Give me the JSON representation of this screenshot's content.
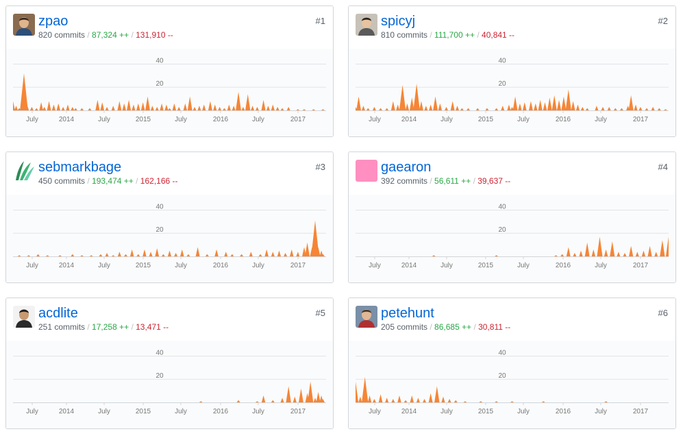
{
  "colors": {
    "area": "#f68535",
    "link": "#0366d6",
    "additions": "#28a745",
    "deletions": "#cb2431",
    "gridline": "#e1e4e8"
  },
  "axis": {
    "y_ticks": [
      "20",
      "40"
    ],
    "x_ticks": [
      "July",
      "2014",
      "July",
      "2015",
      "July",
      "2016",
      "July",
      "2017"
    ]
  },
  "contributors": [
    {
      "rank": "#1",
      "username": "zpao",
      "avatar": "photo-avatar",
      "commits": "820 commits",
      "additions": "87,324 ++",
      "deletions": "131,910 --",
      "chart_data": {
        "type": "area",
        "ylim": [
          0,
          45
        ],
        "peaks": [
          [
            0.0,
            8
          ],
          [
            0.01,
            4
          ],
          [
            0.02,
            2
          ],
          [
            0.035,
            32
          ],
          [
            0.045,
            5
          ],
          [
            0.06,
            3
          ],
          [
            0.075,
            2
          ],
          [
            0.09,
            7
          ],
          [
            0.1,
            3
          ],
          [
            0.115,
            8
          ],
          [
            0.13,
            5
          ],
          [
            0.145,
            6
          ],
          [
            0.16,
            3
          ],
          [
            0.175,
            5
          ],
          [
            0.19,
            3
          ],
          [
            0.2,
            2
          ],
          [
            0.22,
            2
          ],
          [
            0.245,
            2
          ],
          [
            0.27,
            9
          ],
          [
            0.285,
            7
          ],
          [
            0.3,
            3
          ],
          [
            0.32,
            4
          ],
          [
            0.34,
            8
          ],
          [
            0.355,
            6
          ],
          [
            0.37,
            9
          ],
          [
            0.385,
            5
          ],
          [
            0.4,
            6
          ],
          [
            0.415,
            7
          ],
          [
            0.43,
            12
          ],
          [
            0.445,
            4
          ],
          [
            0.46,
            3
          ],
          [
            0.475,
            6
          ],
          [
            0.49,
            5
          ],
          [
            0.5,
            2
          ],
          [
            0.515,
            6
          ],
          [
            0.53,
            3
          ],
          [
            0.55,
            6
          ],
          [
            0.565,
            12
          ],
          [
            0.58,
            3
          ],
          [
            0.595,
            4
          ],
          [
            0.61,
            5
          ],
          [
            0.63,
            8
          ],
          [
            0.645,
            5
          ],
          [
            0.66,
            3
          ],
          [
            0.675,
            2
          ],
          [
            0.69,
            5
          ],
          [
            0.705,
            4
          ],
          [
            0.72,
            16
          ],
          [
            0.735,
            3
          ],
          [
            0.75,
            14
          ],
          [
            0.765,
            4
          ],
          [
            0.78,
            3
          ],
          [
            0.8,
            9
          ],
          [
            0.815,
            4
          ],
          [
            0.83,
            5
          ],
          [
            0.845,
            3
          ],
          [
            0.86,
            2
          ],
          [
            0.88,
            3
          ],
          [
            0.91,
            1
          ],
          [
            0.93,
            1
          ],
          [
            0.96,
            1
          ],
          [
            0.99,
            1
          ]
        ]
      }
    },
    {
      "rank": "#2",
      "username": "spicyj",
      "avatar": "photo-avatar",
      "commits": "810 commits",
      "additions": "111,700 ++",
      "deletions": "40,841 --",
      "chart_data": {
        "type": "area",
        "ylim": [
          0,
          45
        ],
        "peaks": [
          [
            0.0,
            3
          ],
          [
            0.01,
            12
          ],
          [
            0.025,
            4
          ],
          [
            0.04,
            2
          ],
          [
            0.06,
            3
          ],
          [
            0.08,
            2
          ],
          [
            0.1,
            2
          ],
          [
            0.12,
            8
          ],
          [
            0.135,
            5
          ],
          [
            0.15,
            22
          ],
          [
            0.165,
            6
          ],
          [
            0.18,
            11
          ],
          [
            0.195,
            23
          ],
          [
            0.21,
            8
          ],
          [
            0.225,
            4
          ],
          [
            0.24,
            5
          ],
          [
            0.255,
            12
          ],
          [
            0.27,
            6
          ],
          [
            0.29,
            3
          ],
          [
            0.31,
            8
          ],
          [
            0.325,
            4
          ],
          [
            0.34,
            2
          ],
          [
            0.36,
            2
          ],
          [
            0.39,
            2
          ],
          [
            0.42,
            2
          ],
          [
            0.45,
            2
          ],
          [
            0.47,
            4
          ],
          [
            0.49,
            5
          ],
          [
            0.5,
            3
          ],
          [
            0.51,
            12
          ],
          [
            0.525,
            6
          ],
          [
            0.54,
            7
          ],
          [
            0.56,
            8
          ],
          [
            0.575,
            6
          ],
          [
            0.59,
            9
          ],
          [
            0.605,
            7
          ],
          [
            0.62,
            11
          ],
          [
            0.635,
            13
          ],
          [
            0.65,
            9
          ],
          [
            0.665,
            12
          ],
          [
            0.68,
            18
          ],
          [
            0.695,
            8
          ],
          [
            0.71,
            5
          ],
          [
            0.725,
            3
          ],
          [
            0.74,
            2
          ],
          [
            0.77,
            4
          ],
          [
            0.79,
            3
          ],
          [
            0.81,
            3
          ],
          [
            0.83,
            2
          ],
          [
            0.85,
            2
          ],
          [
            0.87,
            4
          ],
          [
            0.88,
            13
          ],
          [
            0.895,
            5
          ],
          [
            0.91,
            3
          ],
          [
            0.93,
            2
          ],
          [
            0.95,
            3
          ],
          [
            0.97,
            2
          ],
          [
            0.99,
            1
          ]
        ]
      }
    },
    {
      "rank": "#3",
      "username": "sebmarkbage",
      "avatar": "leaf-logo",
      "commits": "450 commits",
      "additions": "193,474 ++",
      "deletions": "162,166 --",
      "chart_data": {
        "type": "area",
        "ylim": [
          0,
          45
        ],
        "peaks": [
          [
            0.02,
            1
          ],
          [
            0.05,
            1
          ],
          [
            0.08,
            2
          ],
          [
            0.11,
            1
          ],
          [
            0.15,
            1
          ],
          [
            0.19,
            2
          ],
          [
            0.22,
            1
          ],
          [
            0.25,
            1
          ],
          [
            0.28,
            2
          ],
          [
            0.3,
            3
          ],
          [
            0.32,
            1
          ],
          [
            0.34,
            4
          ],
          [
            0.36,
            2
          ],
          [
            0.38,
            6
          ],
          [
            0.4,
            2
          ],
          [
            0.42,
            6
          ],
          [
            0.44,
            4
          ],
          [
            0.46,
            7
          ],
          [
            0.48,
            2
          ],
          [
            0.5,
            5
          ],
          [
            0.52,
            3
          ],
          [
            0.54,
            6
          ],
          [
            0.56,
            2
          ],
          [
            0.59,
            8
          ],
          [
            0.62,
            2
          ],
          [
            0.65,
            6
          ],
          [
            0.68,
            4
          ],
          [
            0.7,
            2
          ],
          [
            0.73,
            2
          ],
          [
            0.76,
            4
          ],
          [
            0.79,
            2
          ],
          [
            0.81,
            6
          ],
          [
            0.83,
            4
          ],
          [
            0.85,
            5
          ],
          [
            0.87,
            3
          ],
          [
            0.89,
            6
          ],
          [
            0.91,
            4
          ],
          [
            0.93,
            8
          ],
          [
            0.94,
            12
          ],
          [
            0.955,
            8
          ],
          [
            0.965,
            31
          ],
          [
            0.975,
            8
          ],
          [
            0.985,
            5
          ],
          [
            0.99,
            2
          ]
        ]
      }
    },
    {
      "rank": "#4",
      "username": "gaearon",
      "avatar": "pink-square",
      "commits": "392 commits",
      "additions": "56,611 ++",
      "deletions": "39,637 --",
      "chart_data": {
        "type": "area",
        "ylim": [
          0,
          45
        ],
        "peaks": [
          [
            0.25,
            1
          ],
          [
            0.45,
            1
          ],
          [
            0.64,
            1
          ],
          [
            0.66,
            2
          ],
          [
            0.68,
            8
          ],
          [
            0.7,
            3
          ],
          [
            0.72,
            5
          ],
          [
            0.74,
            12
          ],
          [
            0.76,
            6
          ],
          [
            0.78,
            17
          ],
          [
            0.8,
            6
          ],
          [
            0.82,
            13
          ],
          [
            0.84,
            4
          ],
          [
            0.86,
            3
          ],
          [
            0.88,
            9
          ],
          [
            0.9,
            4
          ],
          [
            0.92,
            5
          ],
          [
            0.94,
            9
          ],
          [
            0.96,
            4
          ],
          [
            0.98,
            14
          ],
          [
            1.0,
            17
          ]
        ]
      }
    },
    {
      "rank": "#5",
      "username": "acdlite",
      "avatar": "photo-avatar",
      "commits": "251 commits",
      "additions": "17,258 ++",
      "deletions": "13,471 --",
      "chart_data": {
        "type": "area",
        "ylim": [
          0,
          45
        ],
        "peaks": [
          [
            0.6,
            1
          ],
          [
            0.72,
            2
          ],
          [
            0.78,
            1
          ],
          [
            0.8,
            6
          ],
          [
            0.83,
            2
          ],
          [
            0.86,
            4
          ],
          [
            0.88,
            14
          ],
          [
            0.9,
            5
          ],
          [
            0.92,
            12
          ],
          [
            0.94,
            8
          ],
          [
            0.95,
            18
          ],
          [
            0.965,
            4
          ],
          [
            0.975,
            9
          ],
          [
            0.985,
            6
          ],
          [
            0.99,
            3
          ]
        ]
      }
    },
    {
      "rank": "#6",
      "username": "petehunt",
      "avatar": "photo-avatar",
      "commits": "205 commits",
      "additions": "86,685 ++",
      "deletions": "30,811 --",
      "chart_data": {
        "type": "area",
        "ylim": [
          0,
          45
        ],
        "peaks": [
          [
            0.0,
            18
          ],
          [
            0.015,
            5
          ],
          [
            0.03,
            22
          ],
          [
            0.045,
            6
          ],
          [
            0.06,
            3
          ],
          [
            0.08,
            7
          ],
          [
            0.1,
            4
          ],
          [
            0.12,
            3
          ],
          [
            0.14,
            6
          ],
          [
            0.16,
            2
          ],
          [
            0.18,
            6
          ],
          [
            0.2,
            4
          ],
          [
            0.22,
            3
          ],
          [
            0.24,
            8
          ],
          [
            0.26,
            14
          ],
          [
            0.28,
            5
          ],
          [
            0.3,
            3
          ],
          [
            0.32,
            2
          ],
          [
            0.35,
            1
          ],
          [
            0.4,
            1
          ],
          [
            0.45,
            1
          ],
          [
            0.5,
            1
          ],
          [
            0.6,
            1
          ],
          [
            0.8,
            1
          ]
        ]
      }
    }
  ]
}
